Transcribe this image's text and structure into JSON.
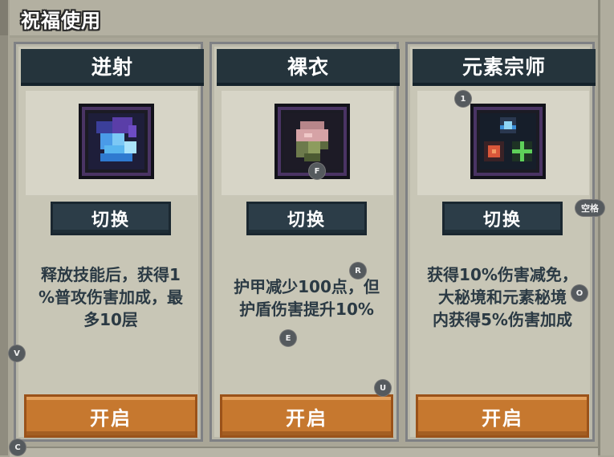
{
  "header": {
    "title": "祝福使用"
  },
  "cards": [
    {
      "name": "迸射",
      "switch_label": "切换",
      "description_lines": [
        "释放技能后，获得1",
        "%普攻伤害加成，最",
        "多10层"
      ],
      "open_label": "开启",
      "icon": "water-splash-icon"
    },
    {
      "name": "裸衣",
      "switch_label": "切换",
      "description_lines": [
        "护甲减少100点，但",
        "护盾伤害提升10%"
      ],
      "open_label": "开启",
      "icon": "bare-body-icon"
    },
    {
      "name": "元素宗师",
      "switch_label": "切换",
      "description_lines": [
        "获得10%伤害减免，",
        "大秘境和元素秘境",
        "内获得5%伤害加成"
      ],
      "open_label": "开启",
      "icon": "elements-icon"
    }
  ],
  "hotkeys": {
    "one": "1",
    "f": "F",
    "space": "空格",
    "r": "R",
    "o": "O",
    "e": "E",
    "v": "V",
    "u": "U",
    "c": "C"
  },
  "colors": {
    "header_bg": "#25343c",
    "switch_bg": "#2c3d48",
    "open_bg": "#c6782f",
    "text_dark": "#2b3a44"
  }
}
